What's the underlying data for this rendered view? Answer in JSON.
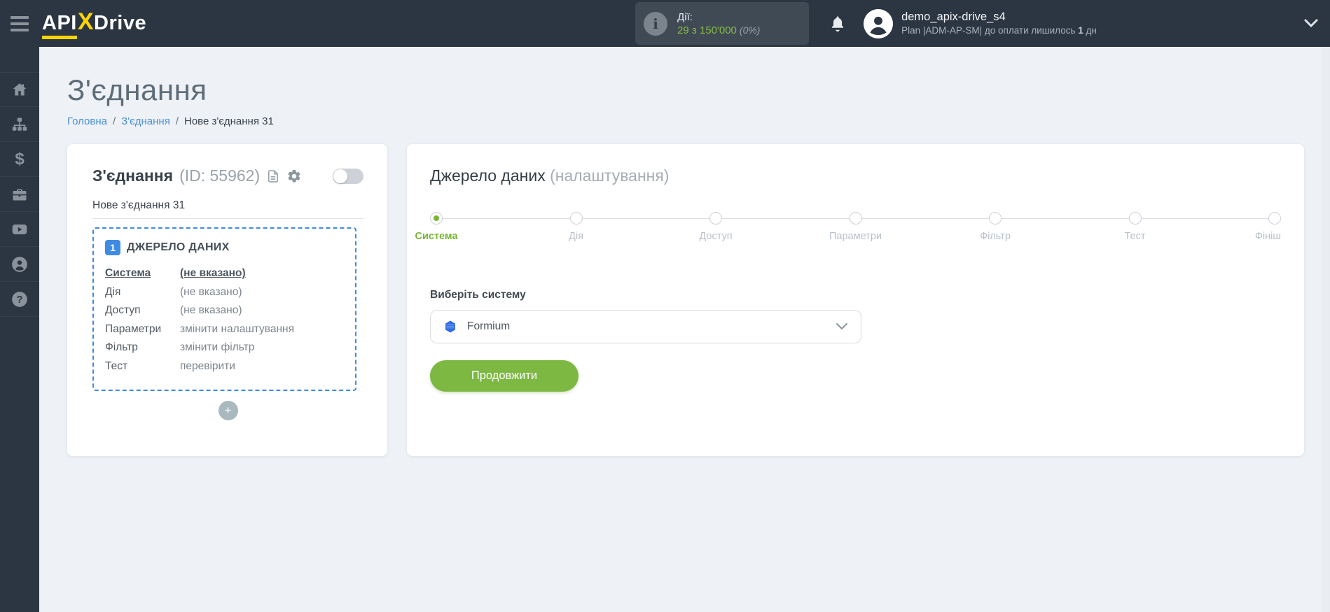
{
  "colors": {
    "topbar_bg": "#2b3642",
    "accent_green": "#7db843",
    "accent_blue": "#3e8be4",
    "brand_yellow": "#ffd400",
    "page_bg": "#eef1f6"
  },
  "topbar": {
    "brand": {
      "api": "API",
      "x": "X",
      "drive": "Drive"
    },
    "counter": {
      "label": "Дії:",
      "value": "29 з 150'000",
      "percent": "(0%)"
    },
    "user": {
      "name": "demo_apix-drive_s4",
      "plan_prefix": "Plan |ADM-AP-SM| до оплати лишилось ",
      "days": "1",
      "plan_suffix": " дн"
    }
  },
  "sidebar": {
    "items": [
      {
        "icon": "home-icon"
      },
      {
        "icon": "sitemap-icon"
      },
      {
        "icon": "dollar-icon"
      },
      {
        "icon": "briefcase-icon"
      },
      {
        "icon": "youtube-icon"
      },
      {
        "icon": "user-icon"
      },
      {
        "icon": "help-icon"
      }
    ],
    "dollar_glyph": "$",
    "help_glyph": "?"
  },
  "page": {
    "title": "З'єднання",
    "breadcrumb": {
      "separator": "/",
      "items": [
        {
          "label": "Головна"
        },
        {
          "label": "З'єднання"
        },
        {
          "label": "Нове з'єднання 31"
        }
      ]
    }
  },
  "connection_card": {
    "title": "З'єднання",
    "id_text": "(ID: 55962)",
    "name": "Нове з'єднання 31",
    "enabled": false,
    "add_label": "+",
    "source_box": {
      "badge": "1",
      "title": "ДЖЕРЕЛО ДАНИХ",
      "rows": [
        {
          "label": "Система",
          "value": "(не вказано)"
        },
        {
          "label": "Дія",
          "value": "(не вказано)"
        },
        {
          "label": "Доступ",
          "value": "(не вказано)"
        },
        {
          "label": "Параметри",
          "value": "змінити налаштування"
        },
        {
          "label": "Фільтр",
          "value": "змінити фільтр"
        },
        {
          "label": "Тест",
          "value": "перевірити"
        }
      ]
    }
  },
  "settings_card": {
    "title": "Джерело даних",
    "subtitle": "(налаштування)",
    "steps": [
      {
        "label": "Система",
        "active": true
      },
      {
        "label": "Дія",
        "active": false
      },
      {
        "label": "Доступ",
        "active": false
      },
      {
        "label": "Параметри",
        "active": false
      },
      {
        "label": "Фільтр",
        "active": false
      },
      {
        "label": "Тест",
        "active": false
      },
      {
        "label": "Фініш",
        "active": false
      }
    ],
    "select_label": "Виберіть систему",
    "selected_system": "Formium",
    "continue_label": "Продовжити"
  }
}
